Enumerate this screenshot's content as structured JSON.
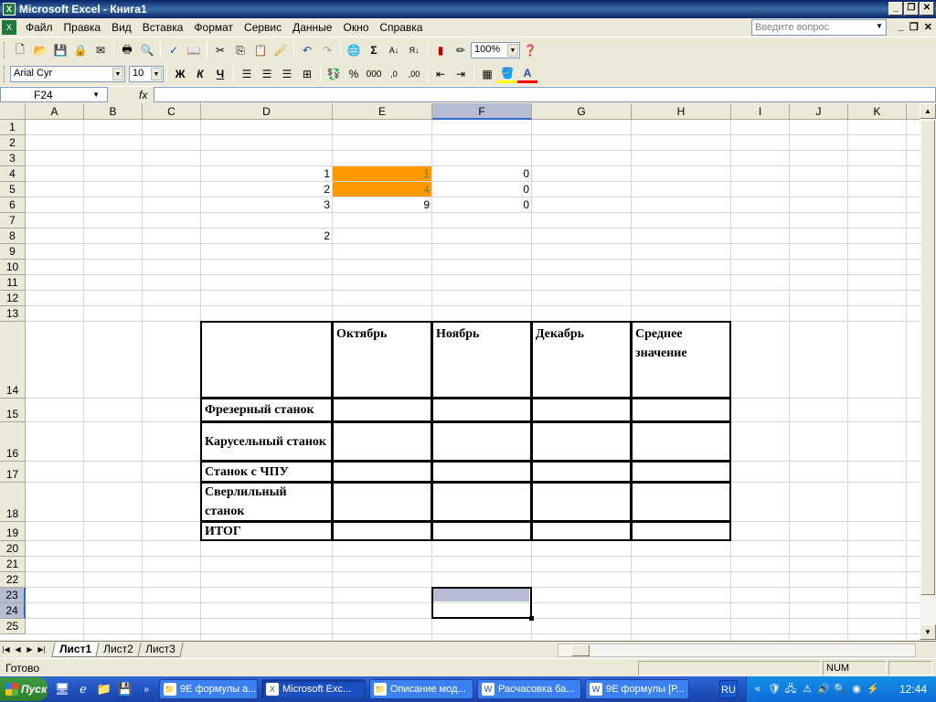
{
  "window": {
    "title": "Microsoft Excel - Книга1",
    "app_icon_glyph": "X"
  },
  "menu": {
    "items": [
      "Файл",
      "Правка",
      "Вид",
      "Вставка",
      "Формат",
      "Сервис",
      "Данные",
      "Окно",
      "Справка"
    ],
    "ask_placeholder": "Введите вопрос"
  },
  "toolbar": {
    "zoom": "100%",
    "font_name": "Arial Cyr",
    "font_size": "10",
    "bold": "Ж",
    "italic": "К",
    "underline": "Ч",
    "percent": "%",
    "thousands": "000",
    "dec_inc": ",0",
    "dec_dec": ",00"
  },
  "formula_bar": {
    "name_box": "F24",
    "fx": "fx",
    "formula": ""
  },
  "columns": [
    "A",
    "B",
    "C",
    "D",
    "E",
    "F",
    "G",
    "H",
    "I",
    "J",
    "K"
  ],
  "selected_column": "F",
  "rows": [
    "1",
    "2",
    "3",
    "4",
    "5",
    "6",
    "7",
    "8",
    "9",
    "10",
    "11",
    "12",
    "13",
    "14",
    "15",
    "16",
    "17",
    "18",
    "19",
    "20",
    "21",
    "22",
    "23",
    "24",
    "25"
  ],
  "selected_rows": [
    "23",
    "24"
  ],
  "cells": {
    "D4": "1",
    "E4": "1",
    "F4": "0",
    "D5": "2",
    "E5": "4",
    "F5": "0",
    "D6": "3",
    "E6": "9",
    "F6": "0",
    "D8": "2"
  },
  "highlight_color": "#ff9900",
  "highlight_text_color": "#808000",
  "table": {
    "headers": [
      "",
      "Октябрь",
      "Ноябрь",
      "Декабрь",
      "Среднее значение"
    ],
    "rows": [
      "Фрезерный станок",
      "Карусельный станок",
      "Станок с ЧПУ",
      "Сверлильный станок",
      "ИТОГ"
    ]
  },
  "sheets": [
    "Лист1",
    "Лист2",
    "Лист3"
  ],
  "active_sheet": "Лист1",
  "status": {
    "text": "Готово",
    "num": "NUM"
  },
  "taskbar": {
    "start": "Пуск",
    "tasks": [
      "9Е формулы а...",
      "Microsoft Exc...",
      "Описание мод...",
      "Расчасовка ба...",
      "9Е формулы [Р..."
    ],
    "active_task": 1,
    "lang": "RU",
    "clock": "12:44"
  }
}
